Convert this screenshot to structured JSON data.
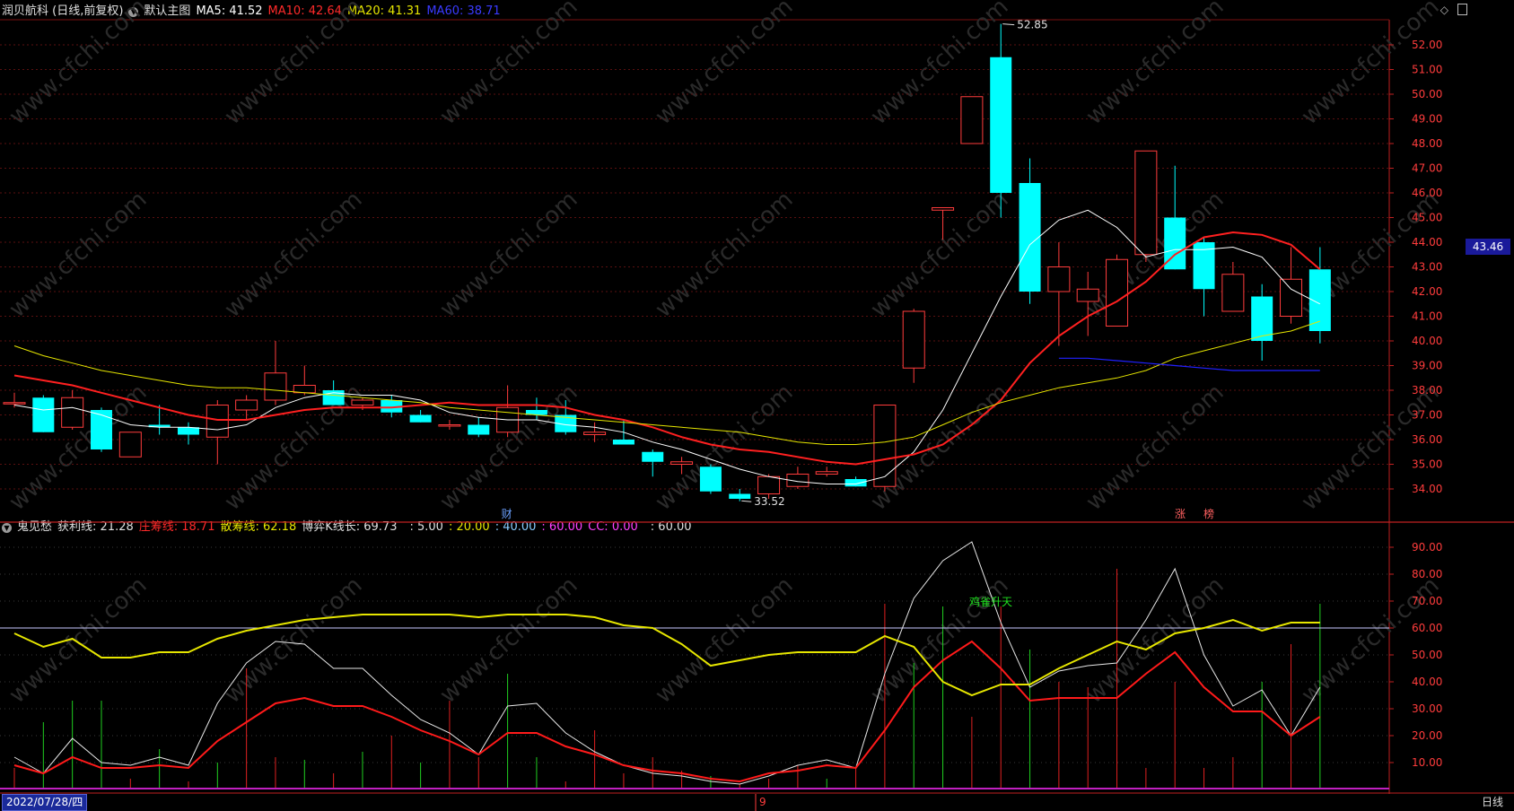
{
  "main_header": {
    "title": "润贝航科 (日线,前复权)",
    "indicator": "默认主图",
    "ma5": "MA5: 41.52",
    "ma10": "MA10: 42.64",
    "ma20": "MA20: 41.31",
    "ma60": "MA60: 38.71"
  },
  "sub_header": {
    "name": "鬼见愁",
    "profit_line": "获利线: 21.28",
    "banker_line": "庄筹线: 18.71",
    "retail_line": "散筹线: 62.18",
    "game_line": "博弈K线长: 69.73",
    "p1": ": 5.00",
    "p2": ": 20.00",
    "p3": ": 40.00",
    "p4": ": 60.00",
    "cc": "CC: 0.00",
    "p5": ": 60.00"
  },
  "price_axis": [
    "52.00",
    "51.00",
    "50.00",
    "49.00",
    "48.00",
    "47.00",
    "46.00",
    "45.00",
    "44.00",
    "43.00",
    "42.00",
    "41.00",
    "40.00",
    "39.00",
    "38.00",
    "37.00",
    "36.00",
    "35.00",
    "34.00"
  ],
  "sub_axis": [
    "90.00",
    "80.00",
    "70.00",
    "60.00",
    "50.00",
    "40.00",
    "30.00",
    "20.00",
    "10.00"
  ],
  "current_price": "43.46",
  "high_label": "52.85",
  "low_label": "33.52",
  "markers": {
    "cai": "财",
    "zhang": "涨",
    "bang": "榜"
  },
  "signal_text": "鸡雀升天",
  "footer": {
    "date": "2022/07/28/四",
    "month_mark": "9",
    "period": "日线"
  },
  "watermark": "www.cfchi.com",
  "colors": {
    "up": "#ff3c3c",
    "down": "#00ffff",
    "ma5": "#ffffff",
    "ma10": "#ff2020",
    "ma20": "#e6e600",
    "ma60": "#2020ff",
    "bg": "#000000"
  },
  "chart_data": [
    {
      "type": "candlestick",
      "title": "润贝航科 (日线,前复权)",
      "ylim": [
        33.5,
        52.8
      ],
      "candles": [
        {
          "o": 37.5,
          "h": 37.9,
          "l": 37.3,
          "c": 37.5
        },
        {
          "o": 37.7,
          "h": 37.8,
          "l": 36.3,
          "c": 36.3
        },
        {
          "o": 36.5,
          "h": 38.0,
          "l": 36.4,
          "c": 37.7
        },
        {
          "o": 37.2,
          "h": 37.3,
          "l": 35.5,
          "c": 35.6
        },
        {
          "o": 35.3,
          "h": 36.3,
          "l": 35.3,
          "c": 36.3
        },
        {
          "o": 36.6,
          "h": 37.4,
          "l": 36.2,
          "c": 36.5
        },
        {
          "o": 36.5,
          "h": 36.7,
          "l": 35.8,
          "c": 36.2
        },
        {
          "o": 36.1,
          "h": 37.6,
          "l": 35.0,
          "c": 37.4
        },
        {
          "o": 37.2,
          "h": 37.8,
          "l": 36.8,
          "c": 37.6
        },
        {
          "o": 37.6,
          "h": 40.0,
          "l": 37.4,
          "c": 38.7
        },
        {
          "o": 37.9,
          "h": 39.0,
          "l": 37.8,
          "c": 38.2
        },
        {
          "o": 38.0,
          "h": 38.4,
          "l": 37.4,
          "c": 37.4
        },
        {
          "o": 37.4,
          "h": 37.7,
          "l": 37.2,
          "c": 37.6
        },
        {
          "o": 37.6,
          "h": 37.8,
          "l": 36.9,
          "c": 37.1
        },
        {
          "o": 37.0,
          "h": 37.2,
          "l": 36.7,
          "c": 36.7
        },
        {
          "o": 36.6,
          "h": 36.8,
          "l": 36.4,
          "c": 36.6
        },
        {
          "o": 36.6,
          "h": 36.9,
          "l": 36.1,
          "c": 36.2
        },
        {
          "o": 36.3,
          "h": 38.2,
          "l": 36.1,
          "c": 37.3
        },
        {
          "o": 37.2,
          "h": 37.7,
          "l": 36.8,
          "c": 37.0
        },
        {
          "o": 37.0,
          "h": 37.6,
          "l": 36.2,
          "c": 36.3
        },
        {
          "o": 36.2,
          "h": 36.7,
          "l": 35.9,
          "c": 36.3
        },
        {
          "o": 36.0,
          "h": 36.8,
          "l": 35.8,
          "c": 35.8
        },
        {
          "o": 35.5,
          "h": 35.6,
          "l": 34.5,
          "c": 35.1
        },
        {
          "o": 35.0,
          "h": 35.3,
          "l": 34.6,
          "c": 35.1
        },
        {
          "o": 34.9,
          "h": 35.0,
          "l": 33.8,
          "c": 33.9
        },
        {
          "o": 33.8,
          "h": 34.0,
          "l": 33.5,
          "c": 33.6
        },
        {
          "o": 33.8,
          "h": 34.6,
          "l": 33.6,
          "c": 34.5
        },
        {
          "o": 34.1,
          "h": 34.9,
          "l": 34.0,
          "c": 34.6
        },
        {
          "o": 34.6,
          "h": 34.9,
          "l": 34.5,
          "c": 34.7
        },
        {
          "o": 34.4,
          "h": 34.5,
          "l": 34.1,
          "c": 34.1
        },
        {
          "o": 34.1,
          "h": 37.4,
          "l": 33.9,
          "c": 37.4
        },
        {
          "o": 38.9,
          "h": 41.3,
          "l": 38.3,
          "c": 41.2
        },
        {
          "o": 45.3,
          "h": 45.4,
          "l": 44.1,
          "c": 45.4
        },
        {
          "o": 48.0,
          "h": 49.9,
          "l": 48.0,
          "c": 49.9
        },
        {
          "o": 51.5,
          "h": 52.85,
          "l": 45.0,
          "c": 46.0
        },
        {
          "o": 46.4,
          "h": 47.4,
          "l": 41.5,
          "c": 42.0
        },
        {
          "o": 42.0,
          "h": 44.0,
          "l": 39.8,
          "c": 43.0
        },
        {
          "o": 41.6,
          "h": 42.8,
          "l": 40.2,
          "c": 42.1
        },
        {
          "o": 40.6,
          "h": 43.5,
          "l": 40.6,
          "c": 43.3
        },
        {
          "o": 43.5,
          "h": 47.7,
          "l": 43.2,
          "c": 47.7
        },
        {
          "o": 45.0,
          "h": 47.1,
          "l": 42.9,
          "c": 42.9
        },
        {
          "o": 44.0,
          "h": 44.2,
          "l": 41.0,
          "c": 42.1
        },
        {
          "o": 41.2,
          "h": 43.2,
          "l": 41.2,
          "c": 42.7
        },
        {
          "o": 41.8,
          "h": 42.3,
          "l": 39.2,
          "c": 40.0
        },
        {
          "o": 41.0,
          "h": 43.8,
          "l": 40.7,
          "c": 42.5
        },
        {
          "o": 42.9,
          "h": 43.8,
          "l": 39.9,
          "c": 40.4
        }
      ],
      "series": [
        {
          "name": "MA5",
          "values": [
            37.4,
            37.2,
            37.3,
            37.0,
            36.6,
            36.5,
            36.5,
            36.4,
            36.6,
            37.3,
            37.7,
            37.9,
            37.8,
            37.8,
            37.6,
            37.1,
            36.9,
            36.8,
            36.8,
            36.6,
            36.5,
            36.3,
            35.9,
            35.6,
            35.2,
            34.8,
            34.5,
            34.3,
            34.2,
            34.2,
            34.5,
            35.5,
            37.2,
            39.5,
            41.8,
            43.9,
            44.9,
            45.3,
            44.6,
            43.4,
            43.7,
            43.7,
            43.8,
            43.4,
            42.1,
            41.5
          ]
        },
        {
          "name": "MA10",
          "values": [
            38.6,
            38.4,
            38.2,
            37.9,
            37.6,
            37.3,
            37.0,
            36.8,
            36.8,
            37.0,
            37.2,
            37.3,
            37.3,
            37.3,
            37.4,
            37.5,
            37.4,
            37.4,
            37.4,
            37.3,
            37.0,
            36.8,
            36.5,
            36.1,
            35.8,
            35.6,
            35.5,
            35.3,
            35.1,
            35.0,
            35.2,
            35.4,
            35.8,
            36.6,
            37.6,
            39.1,
            40.2,
            41.0,
            41.6,
            42.4,
            43.5,
            44.2,
            44.4,
            44.3,
            43.9,
            42.9
          ]
        },
        {
          "name": "MA20",
          "values": [
            39.8,
            39.4,
            39.1,
            38.8,
            38.6,
            38.4,
            38.2,
            38.1,
            38.1,
            38.0,
            37.9,
            37.8,
            37.7,
            37.6,
            37.5,
            37.3,
            37.2,
            37.1,
            37.0,
            36.9,
            36.8,
            36.7,
            36.6,
            36.5,
            36.4,
            36.3,
            36.1,
            35.9,
            35.8,
            35.8,
            35.9,
            36.1,
            36.6,
            37.1,
            37.5,
            37.8,
            38.1,
            38.3,
            38.5,
            38.8,
            39.3,
            39.6,
            39.9,
            40.2,
            40.4,
            40.8
          ]
        },
        {
          "name": "MA60",
          "values": [
            null,
            null,
            null,
            null,
            null,
            null,
            null,
            null,
            null,
            null,
            null,
            null,
            null,
            null,
            null,
            null,
            null,
            null,
            null,
            null,
            null,
            null,
            null,
            null,
            null,
            null,
            null,
            null,
            null,
            null,
            null,
            null,
            null,
            null,
            null,
            null,
            39.3,
            39.3,
            39.2,
            39.1,
            39.0,
            38.9,
            38.8,
            38.8,
            38.8,
            38.8
          ]
        }
      ]
    },
    {
      "type": "line",
      "title": "鬼见愁",
      "ylim": [
        0,
        95
      ],
      "series": [
        {
          "name": "获利线",
          "values": [
            12,
            6,
            19,
            10,
            9,
            12,
            9,
            32,
            47,
            55,
            54,
            45,
            45,
            35,
            26,
            21,
            13,
            31,
            32,
            21,
            14,
            9,
            6,
            5,
            3,
            2,
            5,
            9,
            11,
            8,
            43,
            71,
            85,
            92,
            62,
            38,
            44,
            46,
            47,
            63,
            82,
            50,
            31,
            37,
            20,
            38
          ]
        },
        {
          "name": "庄筹线",
          "values": [
            9,
            6,
            12,
            8,
            8,
            9,
            8,
            18,
            25,
            32,
            34,
            31,
            31,
            27,
            22,
            18,
            13,
            21,
            21,
            16,
            13,
            9,
            7,
            6,
            4,
            3,
            6,
            7,
            9,
            8,
            22,
            38,
            48,
            55,
            45,
            33,
            34,
            34,
            34,
            43,
            51,
            38,
            29,
            29,
            20,
            27
          ]
        },
        {
          "name": "散筹线",
          "values": [
            58,
            53,
            56,
            49,
            49,
            51,
            51,
            56,
            59,
            61,
            63,
            64,
            65,
            65,
            65,
            65,
            64,
            65,
            65,
            65,
            64,
            61,
            60,
            54,
            46,
            48,
            50,
            51,
            51,
            51,
            57,
            53,
            40,
            35,
            39,
            39,
            45,
            50,
            55,
            52,
            58,
            60,
            63,
            59,
            62,
            62
          ]
        },
        {
          "name": "博弈K线长",
          "values": [
            -8,
            25,
            33,
            33,
            -4,
            15,
            -3,
            10,
            -45,
            -12,
            11,
            -6,
            14,
            -20,
            10,
            -33,
            -12,
            43,
            12,
            -3,
            -22,
            -6,
            -12,
            -7,
            5,
            -2,
            -4,
            -9,
            4,
            -8,
            -69,
            47,
            68,
            -27,
            -68,
            52,
            -40,
            -38,
            -82,
            -8,
            -40,
            -8,
            -12,
            40,
            -54,
            69
          ]
        }
      ],
      "reference_line": 60
    }
  ]
}
